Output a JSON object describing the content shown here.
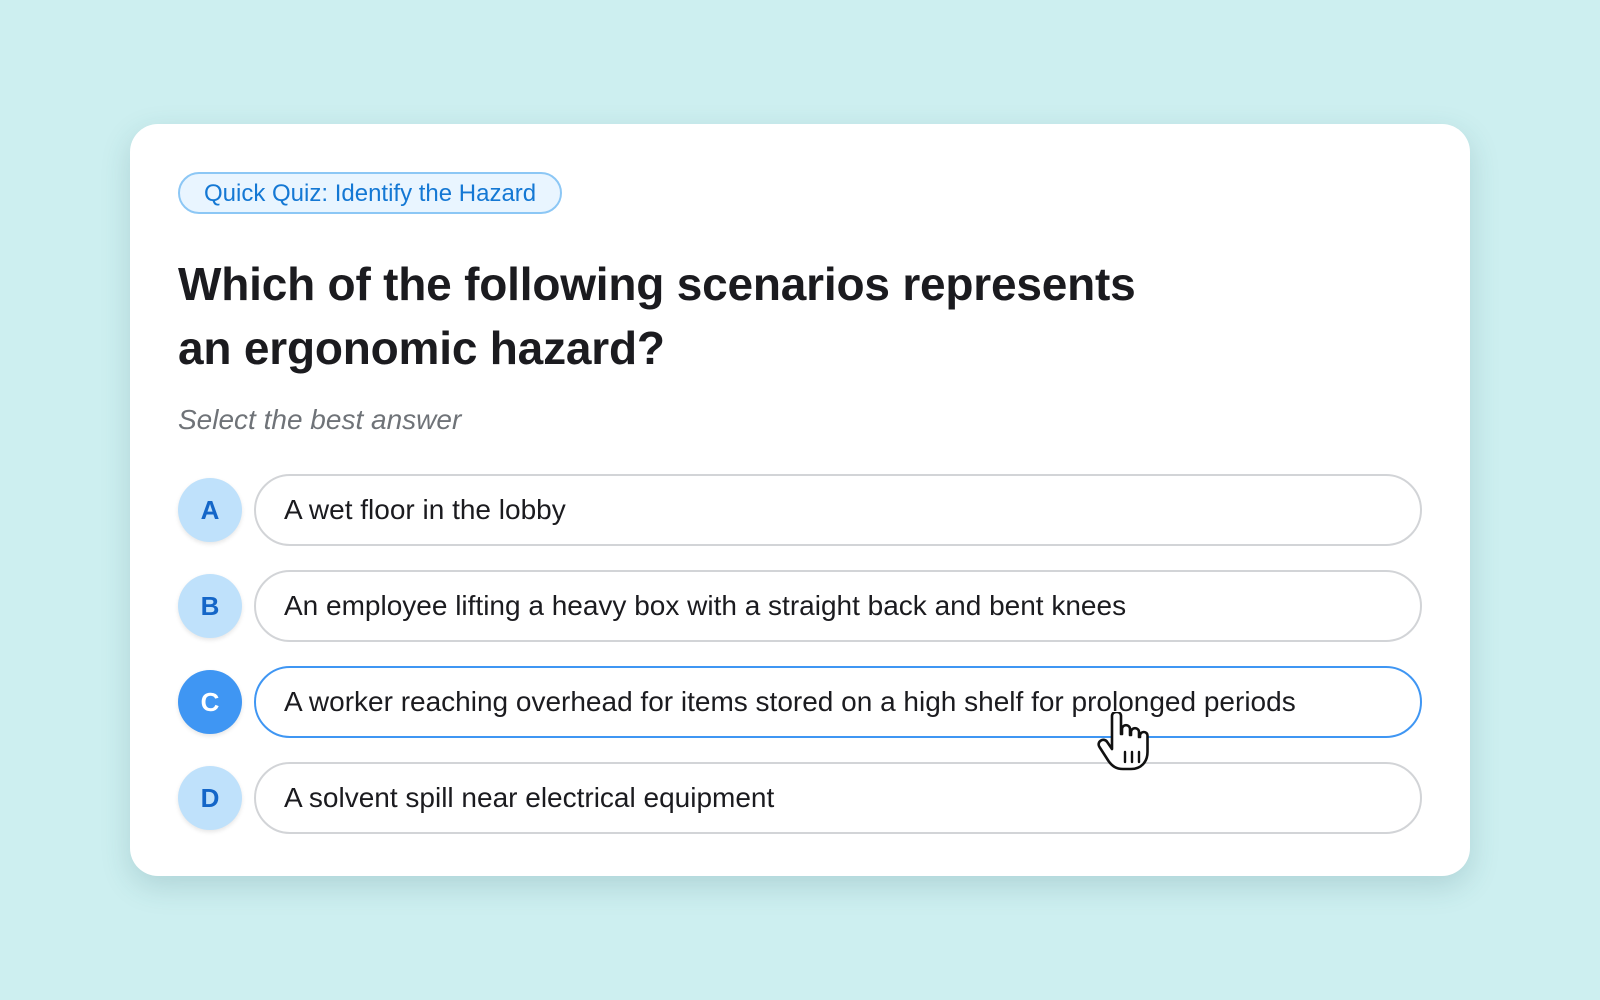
{
  "quiz": {
    "tag": "Quick Quiz: Identify the Hazard",
    "question_line1": "Which of the following scenarios represents",
    "question_line2": "an ergonomic hazard?",
    "hint": "Select the best answer",
    "selected": "C",
    "options": [
      {
        "letter": "A",
        "text": "A wet floor in the lobby"
      },
      {
        "letter": "B",
        "text": "An employee lifting a heavy box with a straight back and bent knees"
      },
      {
        "letter": "C",
        "text": "A worker reaching overhead for items stored on a high shelf for prolonged periods"
      },
      {
        "letter": "D",
        "text": "A solvent spill near electrical equipment"
      }
    ]
  },
  "colors": {
    "background": "#cdeff0",
    "accent": "#3f96f3",
    "letter_bg": "#bfe1fb",
    "tag_text": "#1478d4"
  },
  "icons": {
    "cursor": "hand-pointer-icon"
  }
}
